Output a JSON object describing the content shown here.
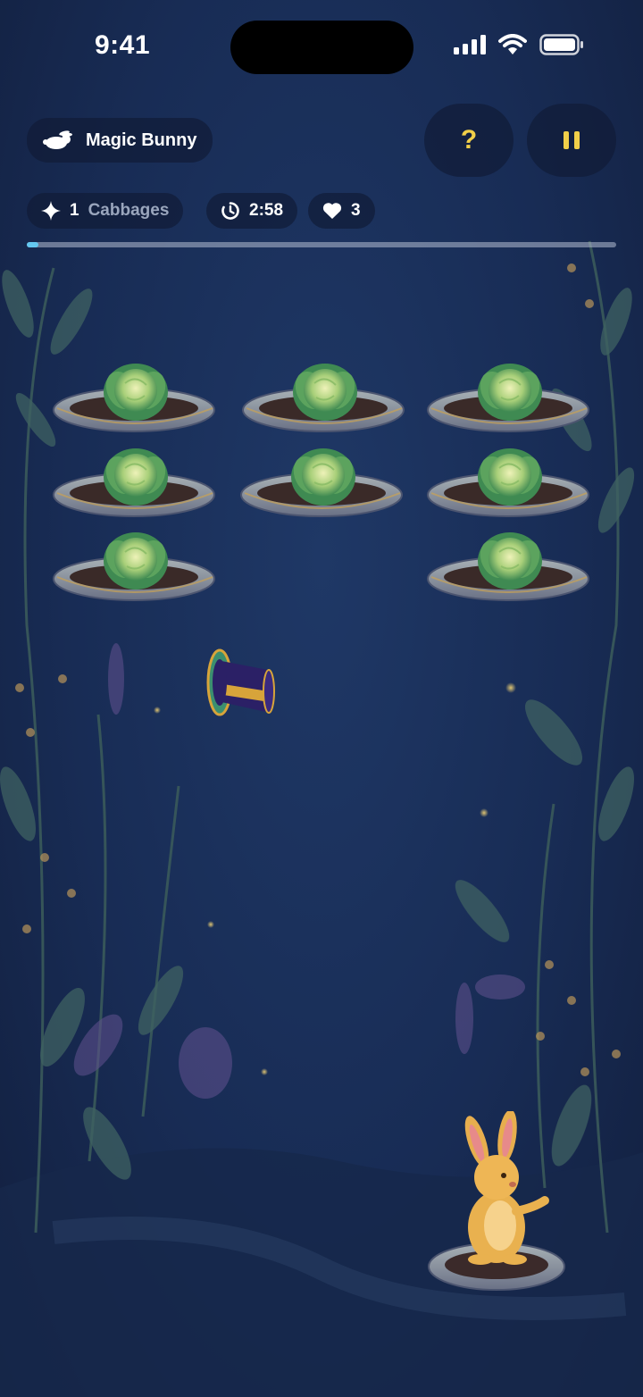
{
  "status_bar": {
    "time": "9:41"
  },
  "header": {
    "title": "Magic Bunny",
    "title_icon": "rabbit-icon",
    "help_label": "?",
    "pause_icon": "pause-icon"
  },
  "stats": {
    "cabbages_count": "1",
    "cabbages_label": "Cabbages",
    "timer": "2:58",
    "lives": "3"
  },
  "progress": {
    "fraction": 0.02
  },
  "colors": {
    "accent": "#f1cf49",
    "progress": "#64c8f0",
    "background": "#1b3260"
  }
}
